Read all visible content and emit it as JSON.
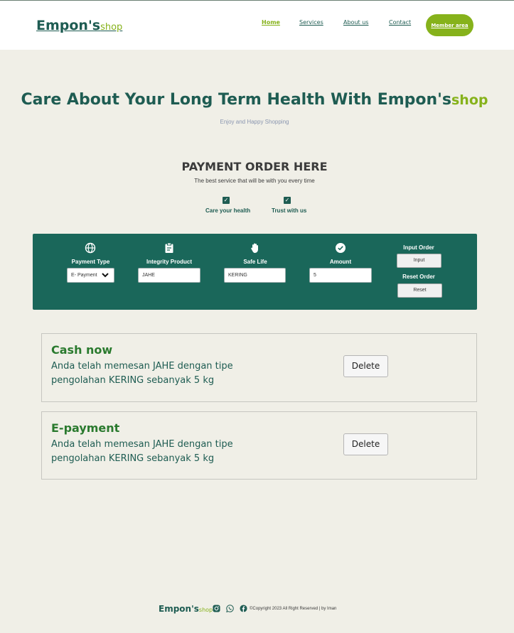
{
  "brand": {
    "name": "Empon's",
    "suffix": "shop"
  },
  "nav": {
    "items": [
      {
        "label": "Home",
        "active": true
      },
      {
        "label": "Services",
        "active": false
      },
      {
        "label": "About us",
        "active": false
      },
      {
        "label": "Contact",
        "active": false
      }
    ],
    "member_label": "Member area"
  },
  "hero": {
    "title": "Care About Your Long Term Health With Empon's",
    "title_suffix": "shop",
    "subtitle": "Enjoy and Happy Shopping"
  },
  "payment": {
    "title": "PAYMENT ORDER HERE",
    "subtitle": "The best service that will be with you every time",
    "checks": [
      {
        "label": "Care your health",
        "icon": "check-icon"
      },
      {
        "label": "Trust with us",
        "icon": "check-icon"
      }
    ]
  },
  "form": {
    "payment_type": {
      "label": "Payment Type",
      "value": "E- Payment",
      "icon": "globe-icon"
    },
    "integrity_product": {
      "label": "Integrity Product",
      "value": "JAHE",
      "icon": "clipboard-icon"
    },
    "safe_life": {
      "label": "Safe Life",
      "value": "KERING",
      "icon": "hand-icon"
    },
    "amount": {
      "label": "Amount",
      "value": "5",
      "icon": "check-circle-icon"
    },
    "input_order": {
      "label": "Input Order",
      "button": "Input"
    },
    "reset_order": {
      "label": "Reset Order",
      "button": "Reset"
    }
  },
  "orders": [
    {
      "title": "Cash now",
      "line1": "Anda telah memesan JAHE dengan tipe",
      "line2": "pengolahan KERING sebanyak 5 kg",
      "delete_label": "Delete"
    },
    {
      "title": "E-payment",
      "line1": "Anda telah memesan JAHE dengan tipe",
      "line2": "pengolahan KERING sebanyak 5 kg",
      "delete_label": "Delete"
    }
  ],
  "footer": {
    "brand": "Empon's",
    "suffix": "shop",
    "copyright": "©Copyright 2023 All Right Reserved | by Iman",
    "icons": [
      "instagram-icon",
      "whatsapp-icon",
      "facebook-icon"
    ]
  },
  "colors": {
    "primary": "#1e5c52",
    "accent": "#86b21b",
    "panel": "#1a675a",
    "background": "#f0efe7"
  }
}
